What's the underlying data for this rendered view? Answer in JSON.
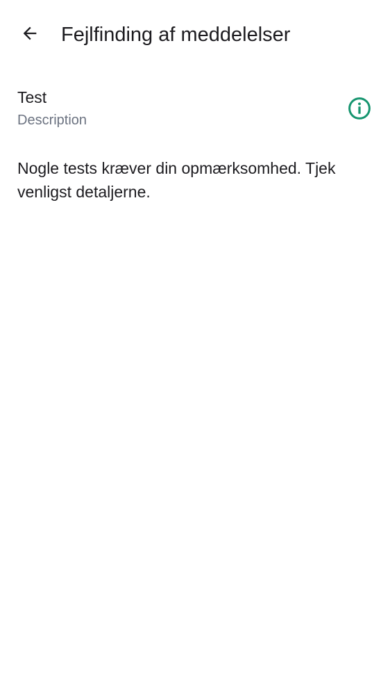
{
  "app_bar": {
    "back_icon": "arrow-left-icon",
    "title": "Fejlfinding af meddelelser"
  },
  "tests": [
    {
      "title": "Test",
      "description": "Description",
      "status_icon": "info-circle-icon",
      "status_color": "#16956f"
    }
  ],
  "message": "Nogle tests kræver din opmærksomhed. Tjek venligst detaljerne."
}
